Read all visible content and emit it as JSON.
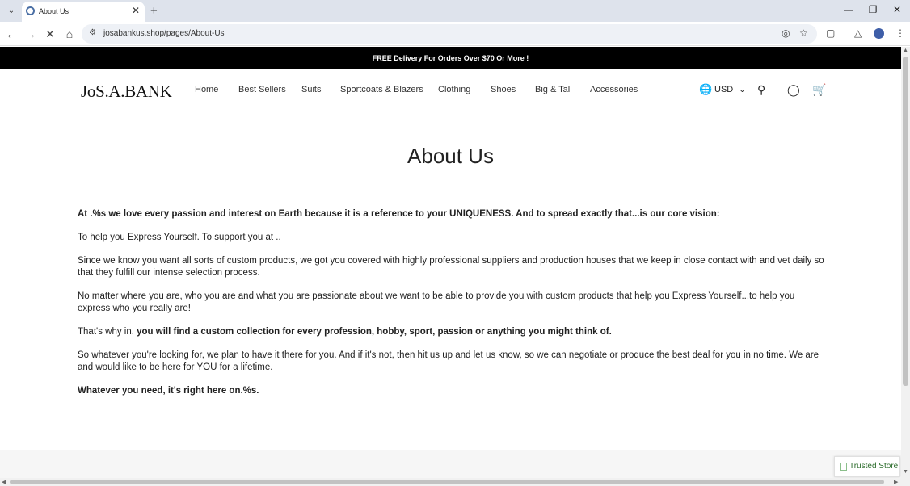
{
  "browser": {
    "tab_title": "About Us",
    "url": "josabankus.shop/pages/About-Us"
  },
  "announcement": "FREE Delivery For Orders Over $70 Or More !",
  "header": {
    "logo": "JoS.A.BANK",
    "nav": [
      "Home",
      "Best Sellers",
      "Suits",
      "Sportcoats & Blazers",
      "Clothing",
      "Shoes",
      "Big & Tall",
      "Accessories"
    ],
    "currency": "USD"
  },
  "page": {
    "title": "About Us",
    "p1": "At .%s we love every passion and interest on Earth because it is a reference to your UNIQUENESS. And to spread exactly that...is our core vision:",
    "p2": "To help you Express Yourself. To support you at ..",
    "p3": "Since we know you want all sorts of custom products, we got you covered with highly professional suppliers and production houses that we keep in close contact with and vet daily so that they fulfill our intense selection process.",
    "p4": "No matter where you are, who you are and what you are passionate about we want to be able to provide you with custom products that help you Express Yourself...to help you express who you really are!",
    "p5_plain": "That's why in. ",
    "p5_bold": "you will find a custom collection for every profession, hobby, sport, passion or anything you might think of.",
    "p6": "So whatever you're looking for, we plan to have it there for you. And if it's not, then hit us up and let us know, so we can negotiate or produce the best deal for you in no time. We are and would like to be here for YOU for a lifetime.",
    "p7": "Whatever you need, it's right here on.%s."
  },
  "trusted_store": "Trusted Store"
}
